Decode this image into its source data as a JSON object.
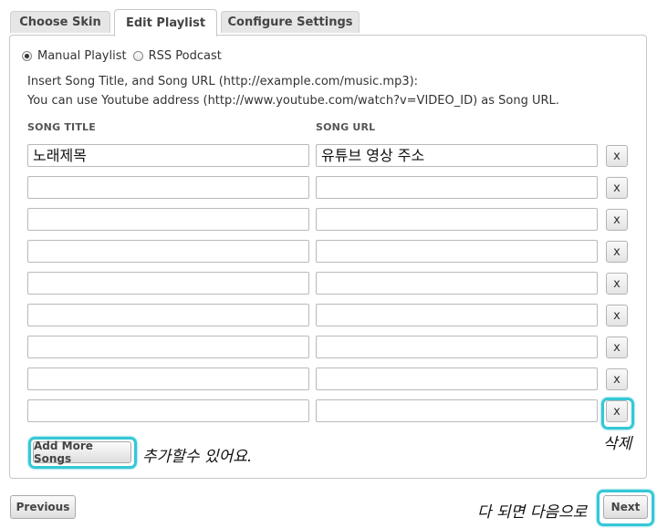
{
  "tabs": [
    {
      "label": "Choose Skin",
      "active": false
    },
    {
      "label": "Edit Playlist",
      "active": true
    },
    {
      "label": "Configure Settings",
      "active": false
    }
  ],
  "playlist_type": {
    "options": [
      {
        "label": "Manual Playlist",
        "checked": true
      },
      {
        "label": "RSS Podcast",
        "checked": false
      }
    ]
  },
  "help": {
    "line1": "Insert Song Title, and Song URL (http://example.com/music.mp3):",
    "line2": "You can use Youtube address (http://www.youtube.com/watch?v=VIDEO_ID) as Song URL."
  },
  "columns": {
    "title": "SONG TITLE",
    "url": "SONG URL"
  },
  "songs": [
    {
      "title": "노래제목",
      "url": "유튜브 영상 주소"
    },
    {
      "title": "",
      "url": ""
    },
    {
      "title": "",
      "url": ""
    },
    {
      "title": "",
      "url": ""
    },
    {
      "title": "",
      "url": ""
    },
    {
      "title": "",
      "url": ""
    },
    {
      "title": "",
      "url": ""
    },
    {
      "title": "",
      "url": ""
    },
    {
      "title": "",
      "url": ""
    }
  ],
  "delete_label": "x",
  "buttons": {
    "add_more": "Add More Songs",
    "previous": "Previous",
    "next": "Next"
  },
  "annotations": {
    "add_note": "추가할수 있어요.",
    "delete_note": "삭제",
    "next_note": "다 되면 다음으로"
  },
  "colors": {
    "highlight": "#35c7d6"
  }
}
